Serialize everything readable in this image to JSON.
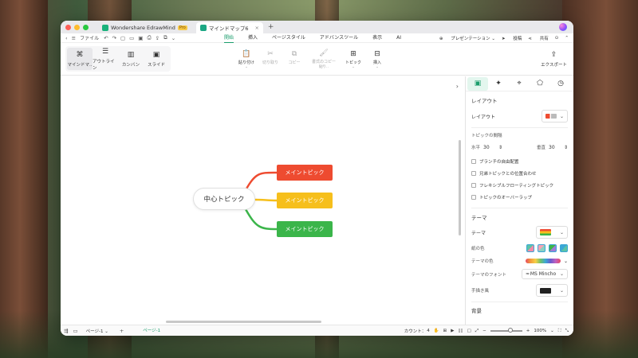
{
  "titlebar": {
    "tabs": [
      {
        "label": "Wondershare EdrawMind",
        "badge": "Pro"
      },
      {
        "label": "マインドマップ6"
      }
    ]
  },
  "menubar": {
    "file_label": "ファイル",
    "ribbon_tabs": [
      "開始",
      "挿入",
      "ページスタイル",
      "アドバンスツール",
      "表示",
      "AI"
    ],
    "active_tab": "開始",
    "presentation": "プレゼンテーション",
    "publish": "投稿",
    "share": "共有"
  },
  "toolbar": {
    "views": [
      {
        "label": "マインドマ..",
        "icon": "mindmap-icon"
      },
      {
        "label": "アウトライン",
        "icon": "outline-icon"
      },
      {
        "label": "カンバン",
        "icon": "kanban-icon"
      },
      {
        "label": "スライド",
        "icon": "slide-icon"
      }
    ],
    "tools": [
      {
        "label": "貼り付け",
        "enabled": true
      },
      {
        "label": "切り取り",
        "enabled": false
      },
      {
        "label": "コピー",
        "enabled": false
      },
      {
        "label": "書式のコピー",
        "sub": "貼り..",
        "enabled": false
      },
      {
        "label": "トピック",
        "enabled": true
      },
      {
        "label": "挿入",
        "enabled": true
      }
    ],
    "export_label": "エクスポート"
  },
  "mindmap": {
    "central": "中心トピック",
    "topics": [
      {
        "label": "メイントピック",
        "color": "#ee4b30"
      },
      {
        "label": "メイントピック",
        "color": "#f6bf1c"
      },
      {
        "label": "メイントピック",
        "color": "#3bb54a"
      }
    ]
  },
  "panel": {
    "layout_section": "レイアウト",
    "layout_label": "レイアウト",
    "spacing_label": "トピックの間隔",
    "horizontal_label": "水平",
    "horizontal_value": "30",
    "vertical_label": "垂直",
    "vertical_value": "30",
    "checkboxes": [
      "ブランチの自由配置",
      "兄弟トピックとの位置合わせ",
      "フレキシブルフローティングトピック",
      "トピックのオーバーラップ"
    ],
    "theme_section": "テーマ",
    "theme_label": "テーマ",
    "paper_color_label": "紙の色",
    "theme_color_label": "テーマの色",
    "theme_font_label": "テーマのフォント",
    "theme_font_value": "MS Mincho",
    "hand_drawn_label": "手描き風",
    "background_section": "背景"
  },
  "statusbar": {
    "page_selector": "ページ-1",
    "page_tab": "ページ-1",
    "count_label": "カウント：",
    "count_value": "4",
    "zoom": "100%",
    "zoom_level": 0.5
  }
}
